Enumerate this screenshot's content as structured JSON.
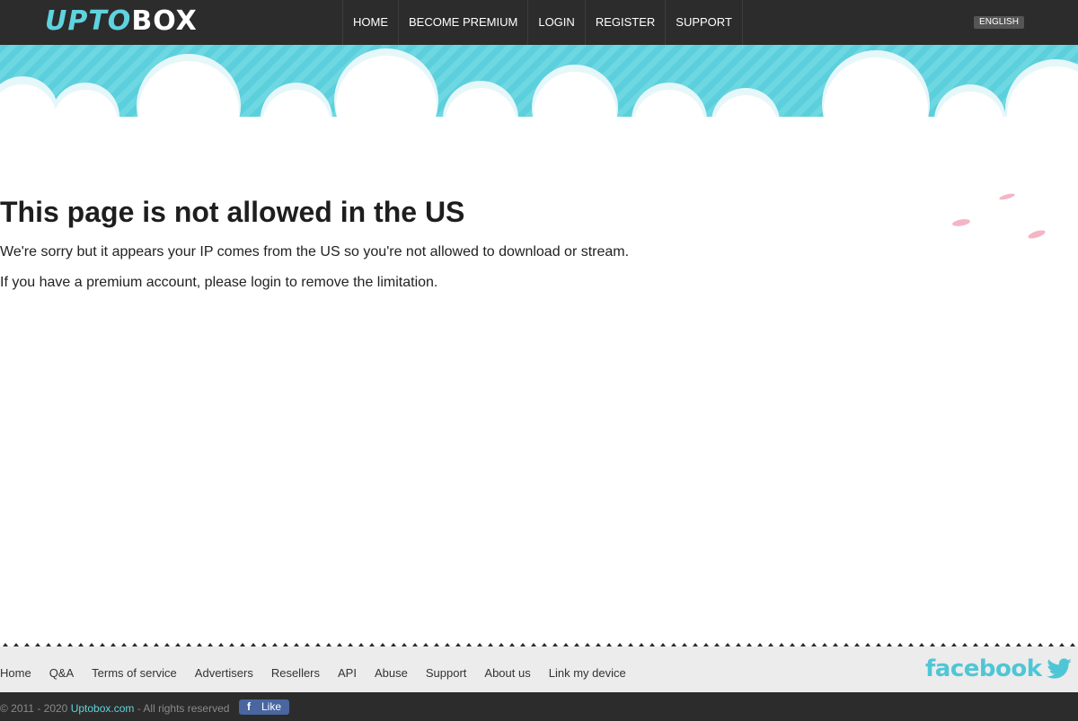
{
  "header": {
    "logo": {
      "part1": "UPTO",
      "part2": "BOX"
    },
    "nav": [
      "HOME",
      "BECOME PREMIUM",
      "LOGIN",
      "REGISTER",
      "SUPPORT"
    ],
    "language": "ENGLISH"
  },
  "main": {
    "title": "This page is not allowed in the US",
    "message1": "We're sorry but it appears your IP comes from the US so you're not allowed to download or stream.",
    "message2": "If you have a premium account, please login to remove the limitation."
  },
  "footer": {
    "links": [
      "Home",
      "Q&A",
      "Terms of service",
      "Advertisers",
      "Resellers",
      "API",
      "Abuse",
      "Support",
      "About us",
      "Link my device"
    ],
    "social_facebook": "facebook",
    "social_twitter_icon": "twitter-bird-icon",
    "copyright_prefix": "© 2011 - 2020",
    "site": "Uptobox.com",
    "rights": "- All rights reserved",
    "like_label": "Like"
  },
  "colors": {
    "topbar": "#2c2c2c",
    "accent": "#5fd3de",
    "footer_bg": "#ececec",
    "like_button": "#4a66a0"
  }
}
